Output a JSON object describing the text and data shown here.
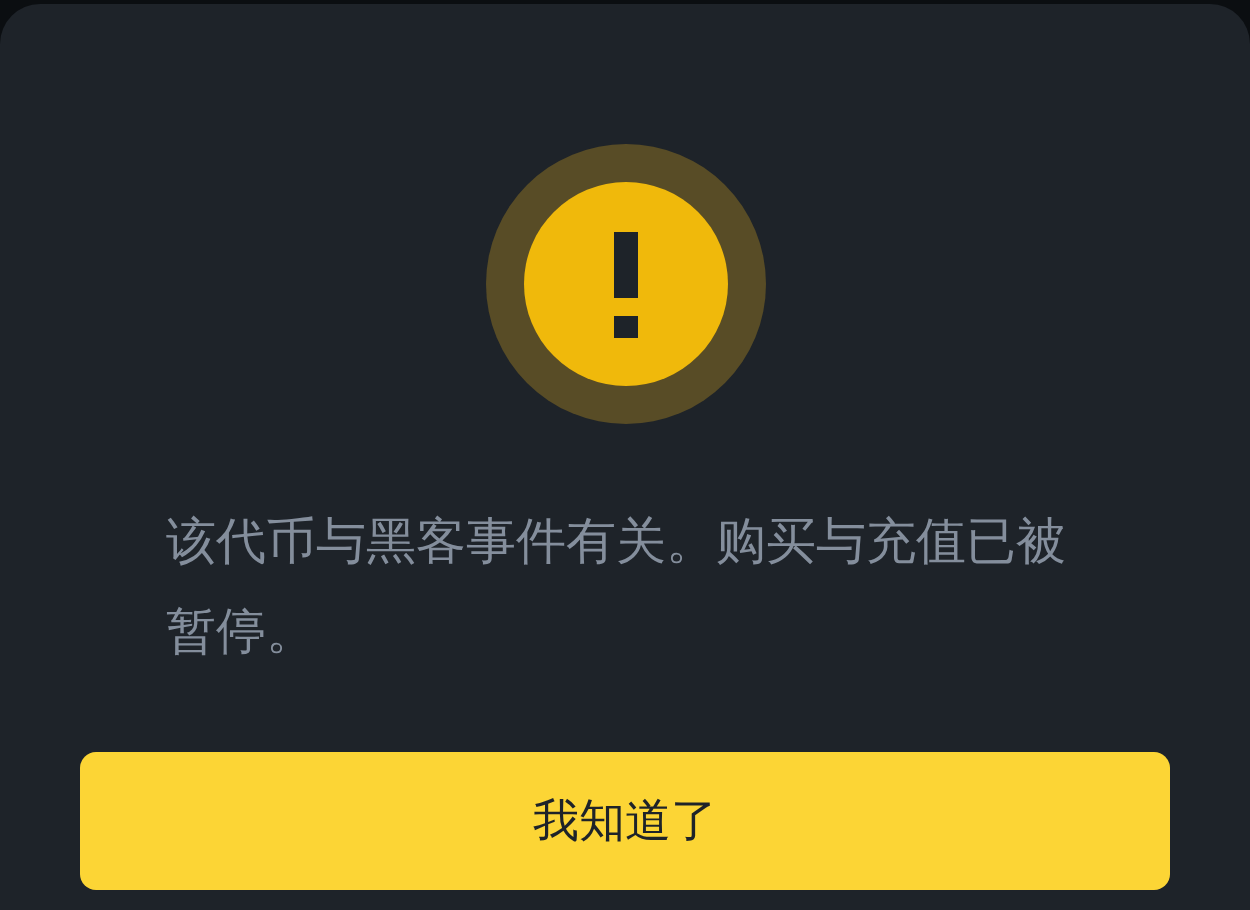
{
  "dialog": {
    "icon": {
      "kind": "warning"
    },
    "message": "该代币与黑客事件有关。购买与充值已被暂停。",
    "button": "我知道了"
  }
}
